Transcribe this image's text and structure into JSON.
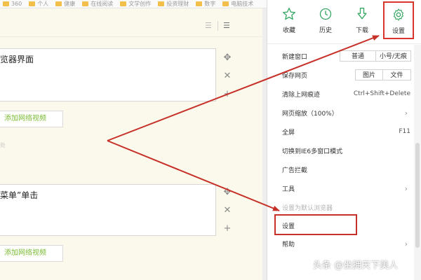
{
  "bookmarks": [
    "360",
    "个人",
    "健康",
    "在线阅读",
    "文学创作",
    "投资理财",
    "数字",
    "电脑技术"
  ],
  "editor": {
    "block1_text": "览器界面",
    "block2_text": "菜单”单击",
    "add_video_label": "添加网络视频",
    "stray_char": "处"
  },
  "menu": {
    "top": [
      {
        "label": "收藏",
        "icon": "star-icon"
      },
      {
        "label": "历史",
        "icon": "clock-icon"
      },
      {
        "label": "下载",
        "icon": "download-icon"
      },
      {
        "label": "设置",
        "icon": "gear-icon"
      }
    ],
    "new_window": {
      "label": "新建窗口",
      "btn1": "普通",
      "btn2": "小号/无痕"
    },
    "save_page": {
      "label": "保存网页",
      "btn1": "图片",
      "btn2": "文件"
    },
    "clear_traces": {
      "label": "清除上网痕迹",
      "shortcut": "Ctrl+Shift+Delete"
    },
    "zoom": {
      "label": "网页缩放（100%）"
    },
    "fullscreen": {
      "label": "全屏",
      "shortcut": "F11"
    },
    "ie6_mode": {
      "label": "切换到IE6多窗口模式"
    },
    "ad_block": {
      "label": "广告拦截"
    },
    "tools": {
      "label": "工具"
    },
    "set_default": {
      "label": "设置为默认浏览器"
    },
    "settings": {
      "label": "设置"
    },
    "help": {
      "label": "帮助"
    }
  },
  "watermark": "头条 @坐拥天下美人",
  "colors": {
    "annotation_red": "#c73028",
    "menu_icon_green": "#3aa865",
    "add_video_green": "#7cbb34"
  }
}
